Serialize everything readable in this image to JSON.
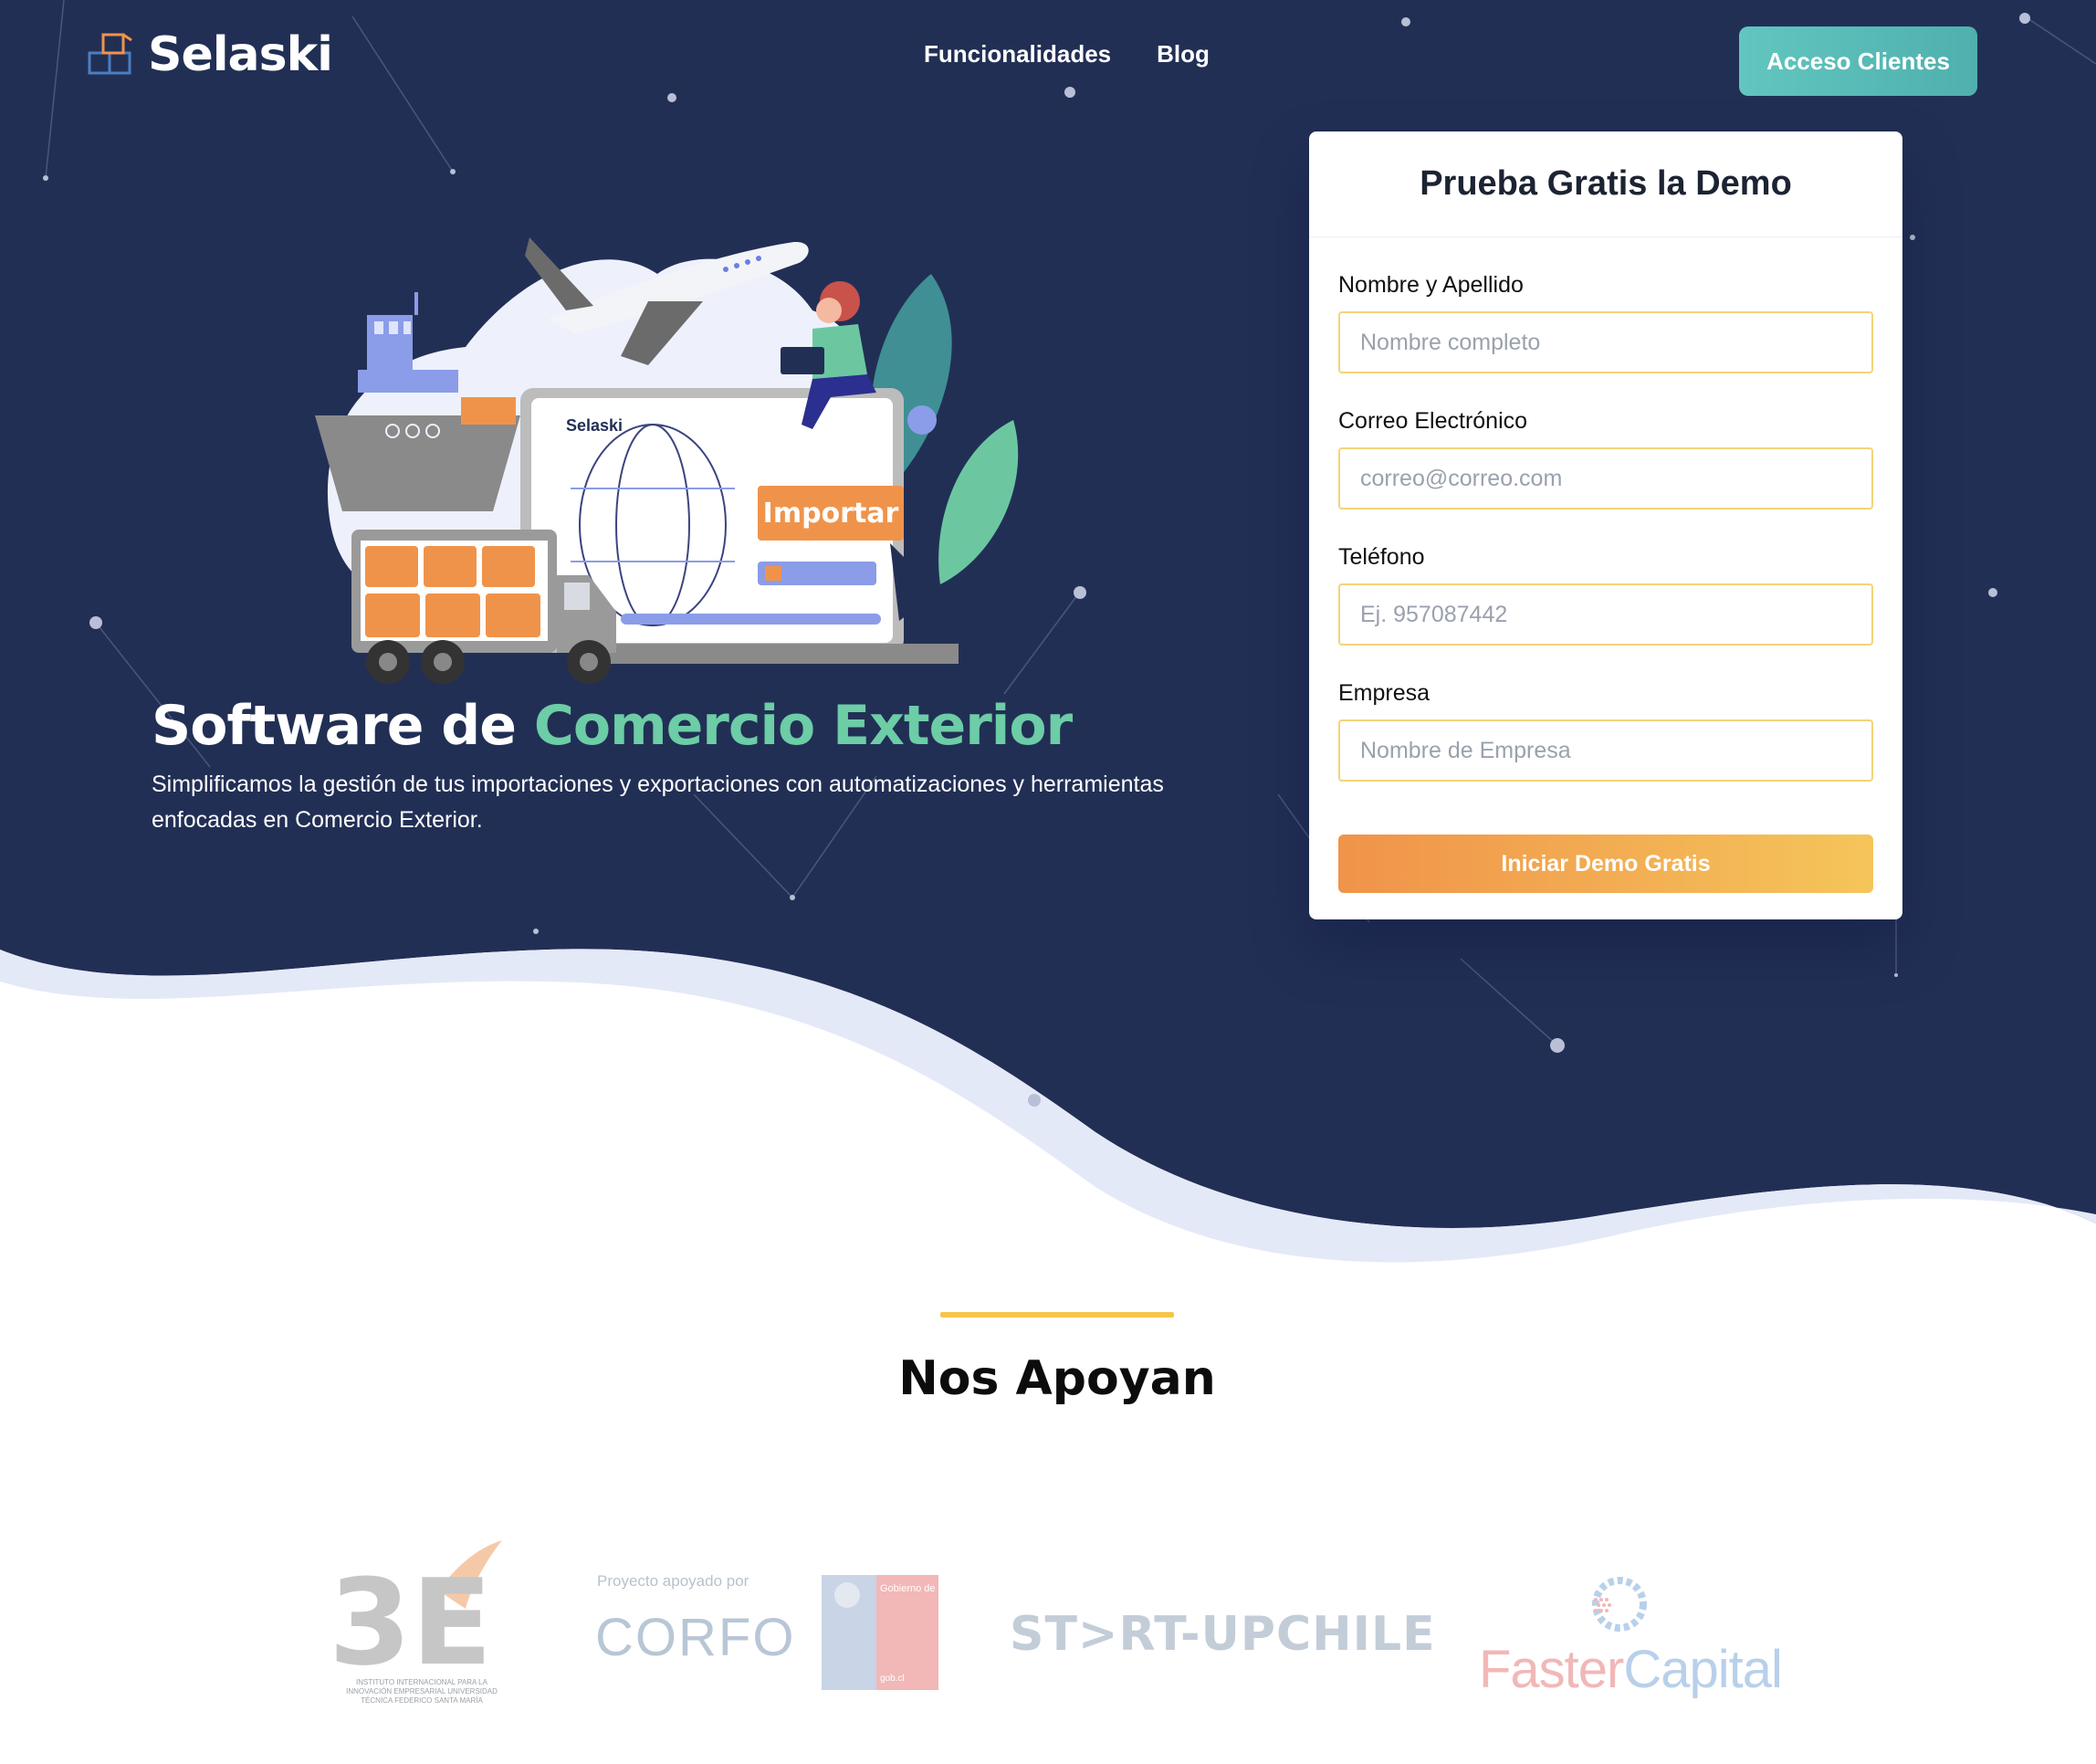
{
  "nav": {
    "brand": "Selaski",
    "links": [
      "Funcionalidades",
      "Blog"
    ],
    "cta": "Acceso Clientes"
  },
  "hero": {
    "title_part1": "Software de ",
    "title_accent": "Comercio Exterior",
    "subtitle": "Simplificamos la gestión de tus importaciones y exportaciones con automatizaciones y herramientas enfocadas en Comercio Exterior.",
    "illustration": {
      "screen_brand": "Selaski",
      "screen_button": "Importar"
    }
  },
  "form": {
    "title": "Prueba Gratis la Demo",
    "fields": [
      {
        "label": "Nombre y Apellido",
        "placeholder": "Nombre completo"
      },
      {
        "label": "Correo Electrónico",
        "placeholder": "correo@correo.com"
      },
      {
        "label": "Teléfono",
        "placeholder": "Ej. 957087442"
      },
      {
        "label": "Empresa",
        "placeholder": "Nombre de Empresa"
      }
    ],
    "submit": "Iniciar Demo Gratis"
  },
  "supporters": {
    "title": "Nos Apoyan",
    "logos": {
      "e3": {
        "mark": "3E",
        "caption": "INSTITUTO INTERNACIONAL PARA LA INNOVACIÓN EMPRESARIAL UNIVERSIDAD TÉCNICA FEDERICO SANTA MARÍA"
      },
      "corfo": {
        "small": "Proyecto apoyado por",
        "name": "CORFO"
      },
      "gobierno": {
        "label": "Gobierno de Chile",
        "small": "gob.cl"
      },
      "startup": {
        "name": "ST>RT-UPCHILE"
      },
      "faster": {
        "name_a": "Faster",
        "name_b": "Capital"
      }
    }
  },
  "colors": {
    "navy": "#222f55",
    "accent_green": "#6ccda6",
    "teal_button": "#5bbcb8",
    "orange": "#f0934a",
    "yellow": "#f5c54b"
  }
}
